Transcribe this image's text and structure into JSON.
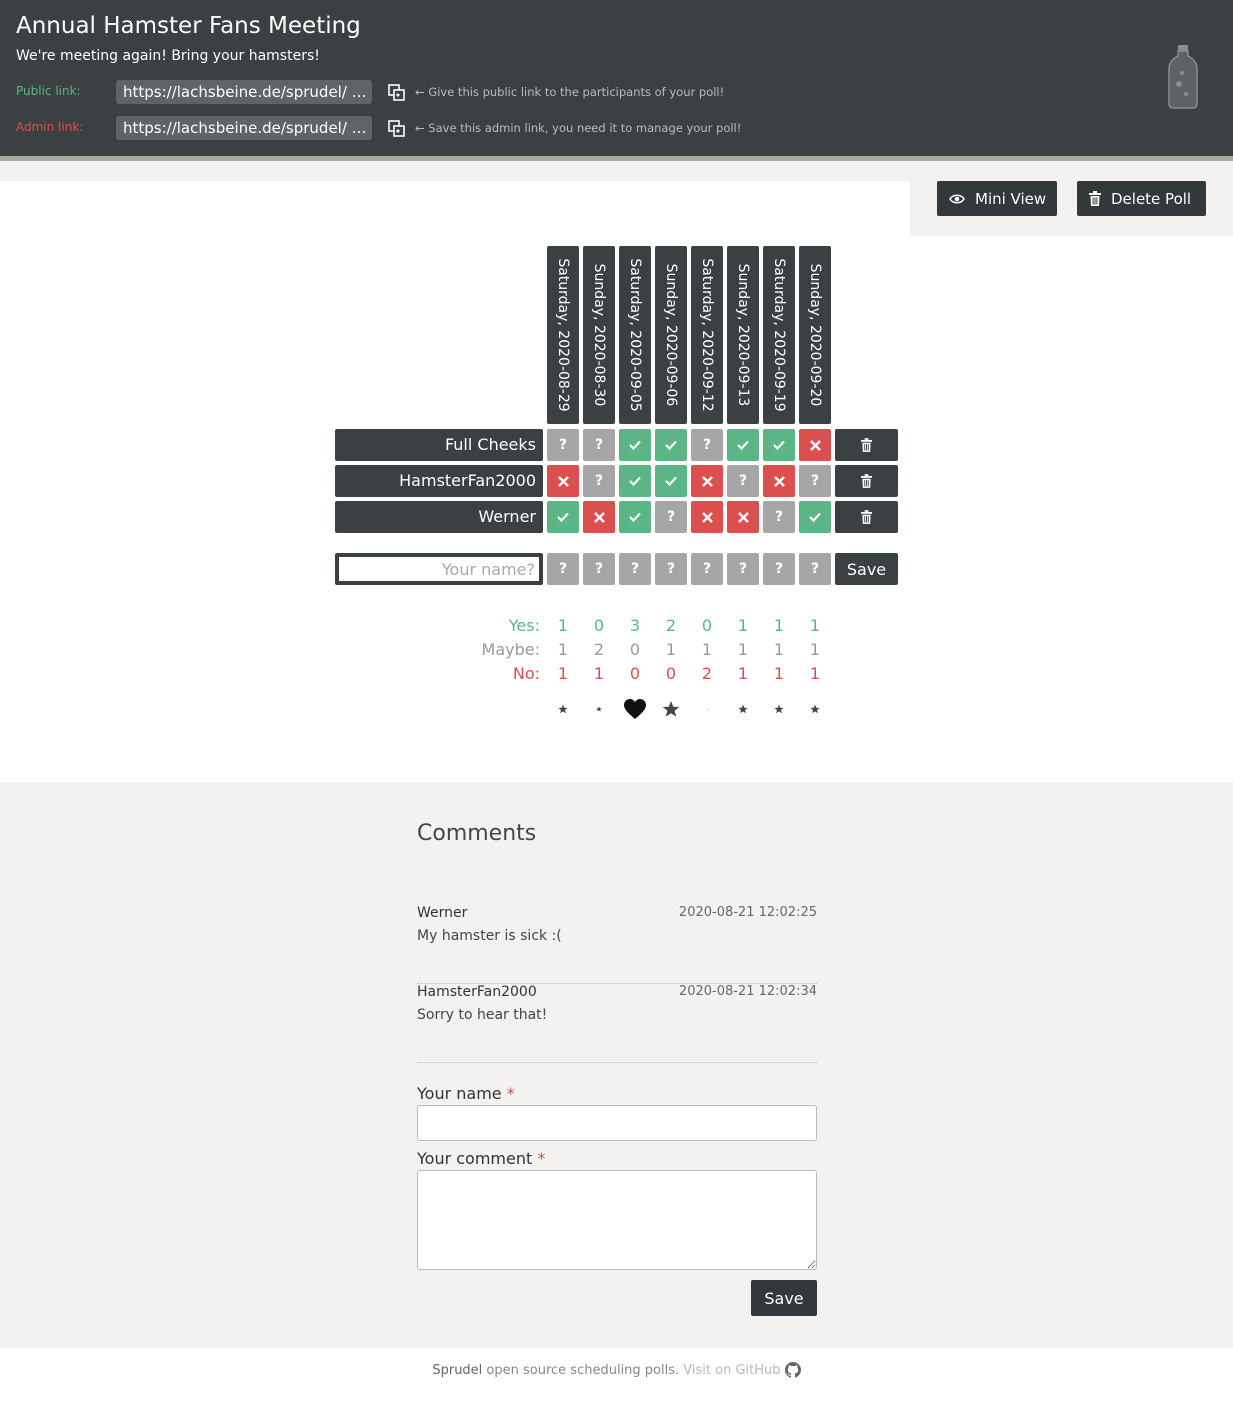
{
  "header": {
    "title": "Annual Hamster Fans Meeting",
    "description": "We're meeting again! Bring your hamsters!",
    "public_link": {
      "label": "Public link:",
      "url": "https://lachsbeine.de/sprudel/ …",
      "hint": "← Give this public link to the participants of your poll!",
      "color": "#5bb585"
    },
    "admin_link": {
      "label": "Admin link:",
      "url": "https://lachsbeine.de/sprudel/ …",
      "hint": "← Save this admin link, you need it to manage your poll!",
      "color": "#dc4f4f"
    },
    "logo_icon": "bottle-icon"
  },
  "actions": {
    "mini_view": "Mini View",
    "delete_poll": "Delete Poll"
  },
  "poll": {
    "dates": [
      "Saturday, 2020-08-29",
      "Sunday, 2020-08-30",
      "Saturday, 2020-09-05",
      "Sunday, 2020-09-06",
      "Saturday, 2020-09-12",
      "Sunday, 2020-09-13",
      "Saturday, 2020-09-19",
      "Sunday, 2020-09-20"
    ],
    "participants": [
      {
        "name": "Full Cheeks",
        "votes": [
          "maybe",
          "maybe",
          "yes",
          "yes",
          "maybe",
          "yes",
          "yes",
          "no"
        ]
      },
      {
        "name": "HamsterFan2000",
        "votes": [
          "no",
          "maybe",
          "yes",
          "yes",
          "no",
          "maybe",
          "no",
          "maybe"
        ]
      },
      {
        "name": "Werner",
        "votes": [
          "yes",
          "no",
          "yes",
          "maybe",
          "no",
          "no",
          "maybe",
          "yes"
        ]
      }
    ],
    "new_entry": {
      "placeholder": "Your name?",
      "default_vote": "?",
      "save_label": "Save"
    },
    "summary": {
      "yes_label": "Yes:",
      "maybe_label": "Maybe:",
      "no_label": "No:",
      "yes": [
        1,
        0,
        3,
        2,
        0,
        1,
        1,
        1
      ],
      "maybe": [
        1,
        2,
        0,
        1,
        1,
        1,
        1,
        1
      ],
      "no": [
        1,
        1,
        0,
        0,
        2,
        1,
        1,
        1
      ]
    },
    "ranking_icons": [
      "star-small",
      "star-tiny",
      "heart",
      "star-large",
      "dot",
      "star-small",
      "star-small",
      "star-small"
    ],
    "colors": {
      "yes": "#5bb585",
      "no": "#dc4f4f",
      "maybe": "#a6a6a6",
      "dark": "#3b4043"
    }
  },
  "comments": {
    "title": "Comments",
    "items": [
      {
        "author": "Werner",
        "time": "2020-08-21 12:02:25",
        "text": "My hamster is sick :("
      },
      {
        "author": "HamsterFan2000",
        "time": "2020-08-21 12:02:34",
        "text": "Sorry to hear that!"
      }
    ],
    "form": {
      "name_label": "Your name",
      "comment_label": "Your comment",
      "required_mark": "*",
      "save_label": "Save"
    }
  },
  "footer": {
    "brand": "Sprudel",
    "text": " open source scheduling polls. ",
    "github_link": "Visit on GitHub"
  }
}
